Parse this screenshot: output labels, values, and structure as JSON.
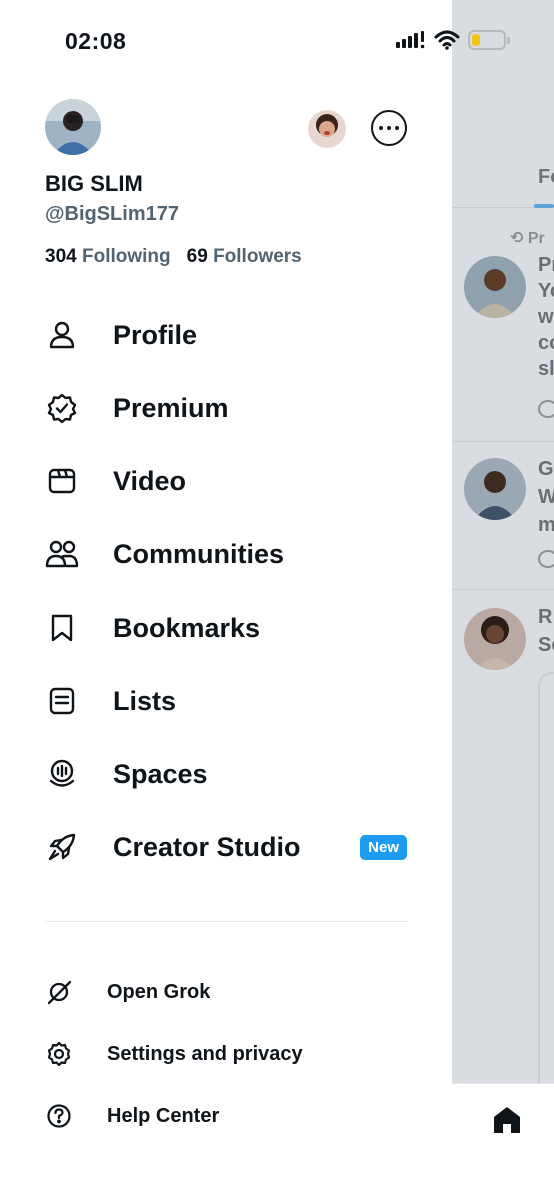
{
  "status_bar": {
    "time": "02:08"
  },
  "profile": {
    "display_name": "BIG SLIM",
    "handle": "@BigSLim177",
    "following_count": "304",
    "following_label": "Following",
    "followers_count": "69",
    "followers_label": "Followers"
  },
  "menu": {
    "items": [
      {
        "label": "Profile",
        "icon": "person-icon"
      },
      {
        "label": "Premium",
        "icon": "verified-badge-icon"
      },
      {
        "label": "Video",
        "icon": "video-clapper-icon"
      },
      {
        "label": "Communities",
        "icon": "people-icon"
      },
      {
        "label": "Bookmarks",
        "icon": "bookmark-icon"
      },
      {
        "label": "Lists",
        "icon": "list-icon"
      },
      {
        "label": "Spaces",
        "icon": "spaces-mic-icon"
      },
      {
        "label": "Creator Studio",
        "icon": "rocket-icon",
        "badge": "New"
      }
    ]
  },
  "secondary_menu": {
    "items": [
      {
        "label": "Open Grok",
        "icon": "grok-icon"
      },
      {
        "label": "Settings and privacy",
        "icon": "gear-icon"
      },
      {
        "label": "Help Center",
        "icon": "help-icon"
      }
    ]
  },
  "background_timeline": {
    "tab_label": "Fo",
    "retweet_text": "Pr",
    "posts": [
      {
        "lines": [
          "Pr",
          "Yo",
          "w",
          "co",
          "sl"
        ]
      },
      {
        "lines": [
          "G",
          "W",
          "m"
        ]
      },
      {
        "lines": [
          "R",
          "Se"
        ]
      }
    ]
  },
  "colors": {
    "accent": "#1d9bf0",
    "text_primary": "#0f1419",
    "text_secondary": "#536471",
    "battery": "#f5c518"
  }
}
